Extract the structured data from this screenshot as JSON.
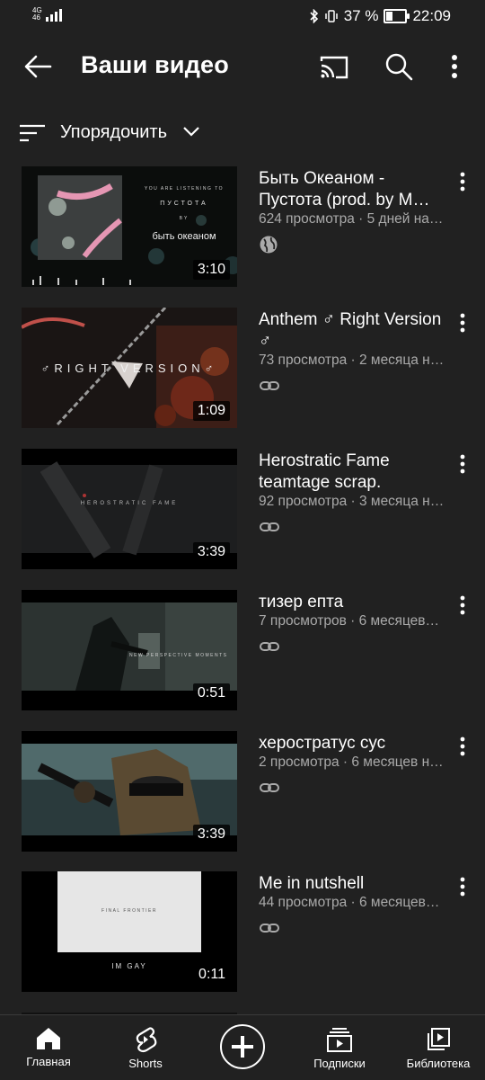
{
  "status_bar": {
    "network": "4G",
    "network_sub": "46",
    "battery_percent": "37 %",
    "battery_level": 0.37,
    "time": "22:09"
  },
  "app_bar": {
    "title": "Ваши видео",
    "icons": [
      "back-arrow-icon",
      "cast-icon",
      "search-icon",
      "more-vert-icon"
    ]
  },
  "sort": {
    "label": "Упорядочить",
    "icons": [
      "sort-icon",
      "chevron-down-icon"
    ]
  },
  "videos": [
    {
      "title": "Быть Океаном  - Пустота (prod. by M…",
      "meta": "624 просмотра · 5 дней на…",
      "duration": "3:10",
      "visibility": "globe-icon",
      "thumb_texts": [
        "YOU ARE LISTENING TO",
        "ПУСТОТА",
        "BY",
        "быть океаном"
      ]
    },
    {
      "title": "Anthem ♂ Right Version ♂",
      "meta": "73 просмотра · 2 месяца н…",
      "duration": "1:09",
      "visibility": "link-icon",
      "thumb_texts": [
        "♂RIGHT VERSION♂"
      ]
    },
    {
      "title": "Herostratic Fame teamtage scrap.",
      "meta": "92 просмотра · 3 месяца н…",
      "duration": "3:39",
      "visibility": "link-icon",
      "thumb_texts": [
        "HEROSTRATIC FAME"
      ]
    },
    {
      "title": "тизер епта",
      "meta": "7 просмотров · 6 месяцев…",
      "duration": "0:51",
      "visibility": "link-icon",
      "thumb_texts": [
        "NEW PERSPECTIVE MOMENTS"
      ]
    },
    {
      "title": "херостратус сус",
      "meta": "2 просмотра · 6 месяцев н…",
      "duration": "3:39",
      "visibility": "link-icon",
      "thumb_texts": []
    },
    {
      "title": "Me in nutshell",
      "meta": "44 просмотра · 6 месяцев…",
      "duration": "0:11",
      "visibility": "link-icon",
      "thumb_texts": [
        "FINAL FRONTIER",
        "IM GAY"
      ]
    }
  ],
  "bottom_nav": [
    {
      "label": "Главная",
      "icon": "home-icon"
    },
    {
      "label": "Shorts",
      "icon": "shorts-icon"
    },
    {
      "label": "",
      "icon": "create-plus-icon"
    },
    {
      "label": "Подписки",
      "icon": "subscriptions-icon"
    },
    {
      "label": "Библиотека",
      "icon": "library-icon"
    }
  ],
  "colors": {
    "background": "#212121",
    "text_primary": "#ffffff",
    "text_secondary": "#aaaaaa"
  }
}
